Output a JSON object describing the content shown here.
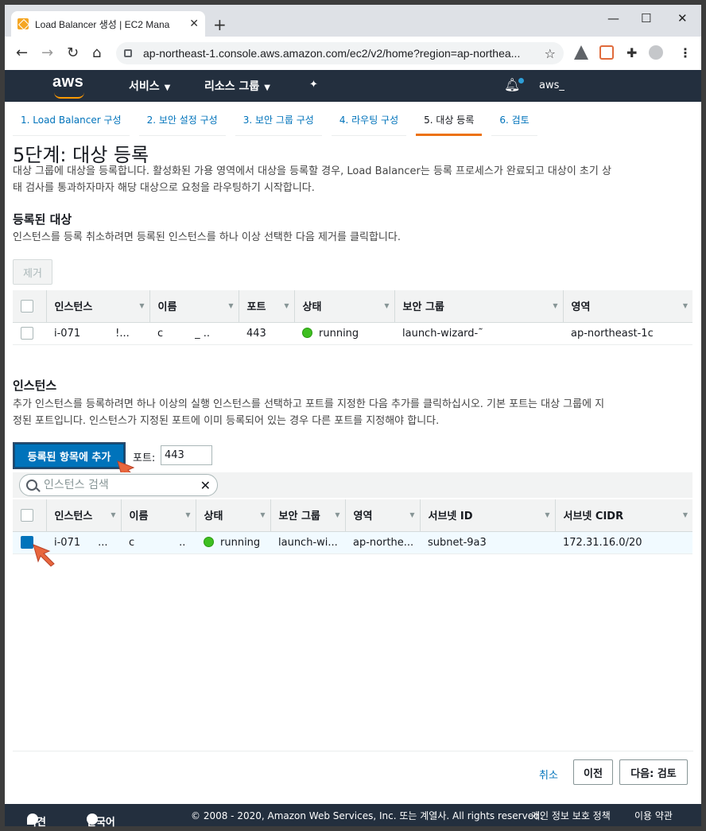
{
  "browser": {
    "tab_title": "Load Balancer 생성 | EC2 Mana",
    "url": "ap-northeast-1.console.aws.amazon.com/ec2/v2/home?region=ap-northea..."
  },
  "awsnav": {
    "logo": "aws",
    "services": "서비스",
    "resource_groups": "리소스 그룹",
    "user": "aws_"
  },
  "steps": [
    {
      "label": "1. Load Balancer 구성"
    },
    {
      "label": "2. 보안 설정 구성"
    },
    {
      "label": "3. 보안 그룹 구성"
    },
    {
      "label": "4. 라우팅 구성"
    },
    {
      "label": "5. 대상 등록"
    },
    {
      "label": "6. 검토"
    }
  ],
  "page": {
    "title": "5단계: 대상 등록",
    "description_line1": "대상 그룹에 대상을 등록합니다. 활성화된 가용 영역에서 대상을 등록할 경우, Load Balancer는 등록 프로세스가 완료되고 대상이 초기 상",
    "description_line2": "태 검사를 통과하자마자 해당 대상으로 요청을 라우팅하기 시작합니다."
  },
  "registered": {
    "heading": "등록된 대상",
    "description": "인스턴스를 등록 취소하려면 등록된 인스턴스를 하나 이상 선택한 다음 제거를 클릭합니다.",
    "remove_label": "제거",
    "columns": [
      "인스턴스",
      "이름",
      "포트",
      "상태",
      "보안 그룹",
      "영역"
    ],
    "row": {
      "instance": "i-071",
      "instance_trail": "!...",
      "name": "c",
      "name_trail": "_ ..",
      "port": "443",
      "status": "running",
      "security_group": "launch-wizard-˜",
      "zone": "ap-northeast-1c"
    }
  },
  "instances": {
    "heading": "인스턴스",
    "description_line1": "추가 인스턴스를 등록하려면 하나 이상의 실행 인스턴스를 선택하고 포트를 지정한 다음 추가를 클릭하십시오. 기본 포트는 대상 그룹에 지",
    "description_line2": "정된 포트입니다. 인스턴스가 지정된 포트에 이미 등록되어 있는 경우 다른 포트를 지정해야 합니다.",
    "add_label": "등록된 항목에 추가",
    "port_label": "포트:",
    "port_value": "443",
    "search_placeholder": "인스턴스 검색",
    "columns": [
      "인스턴스",
      "이름",
      "상태",
      "보안 그룹",
      "영역",
      "서브넷 ID",
      "서브넷 CIDR"
    ],
    "row": {
      "instance": "i-071",
      "instance_trail": "...",
      "name": "c",
      "name_trail": "..",
      "status": "running",
      "security_group": "launch-wi...",
      "zone": "ap-northe...",
      "subnet_id": "subnet-9a3",
      "subnet_cidr": "172.31.16.0/20"
    }
  },
  "actions": {
    "cancel": "취소",
    "previous": "이전",
    "next": "다음: 검토"
  },
  "footer": {
    "feedback": "의견",
    "language": "한국어",
    "copyright": "© 2008 - 2020, Amazon Web Services, Inc. 또는 계열사. All rights reserved.",
    "privacy": "개인 정보 보호 정책",
    "terms": "이용 약관"
  },
  "colors": {
    "accent": "#0073bb",
    "nav_bg": "#232f3e",
    "active_step": "#ec7211",
    "running": "#3ebf20",
    "arrow": "#e8663d"
  }
}
